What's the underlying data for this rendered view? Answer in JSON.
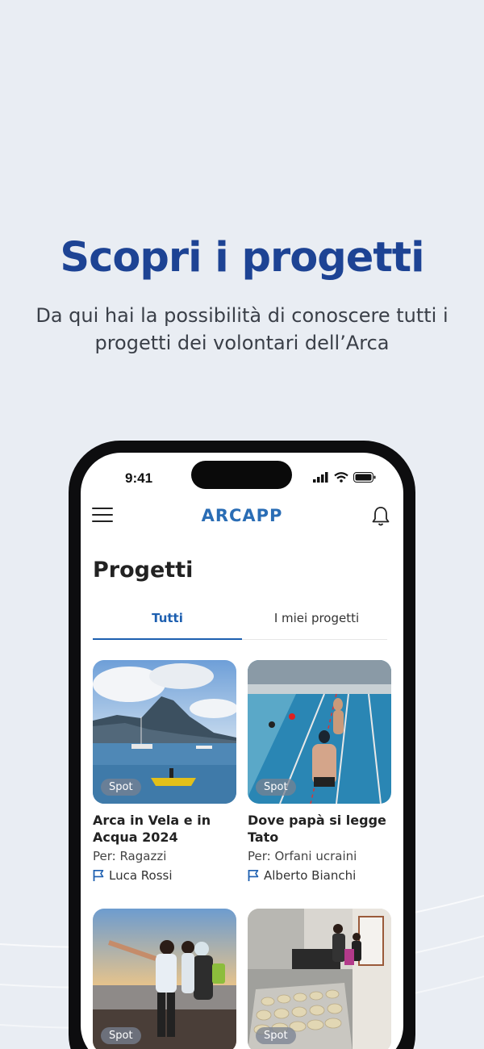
{
  "hero": {
    "title": "Scopri i progetti",
    "subtitle": "Da qui hai la possibilità di conoscere tutti i progetti dei volontari dell’Arca"
  },
  "status_bar": {
    "time": "9:41"
  },
  "app": {
    "brand": "ARCAPP",
    "page_title": "Progetti",
    "tabs": [
      {
        "label": "Tutti",
        "active": true
      },
      {
        "label": "I miei progetti",
        "active": false
      }
    ],
    "projects": [
      {
        "title": "Arca in Vela e in Acqua 2024",
        "badge": "Spot",
        "for": "Per: Ragazzi",
        "owner": "Luca Rossi"
      },
      {
        "title": "Dove papà si legge Tato",
        "badge": "Spot",
        "for": "Per: Orfani ucraini",
        "owner": "Alberto Bianchi"
      },
      {
        "badge": "Spot"
      },
      {
        "badge": "Spot"
      }
    ]
  },
  "colors": {
    "brand_blue": "#1d4394",
    "accent": "#1d5fb0",
    "background": "#e9edf3"
  },
  "icons": [
    "menu-icon",
    "bell-icon",
    "flag-icon",
    "signal-icon",
    "wifi-icon",
    "battery-icon"
  ]
}
